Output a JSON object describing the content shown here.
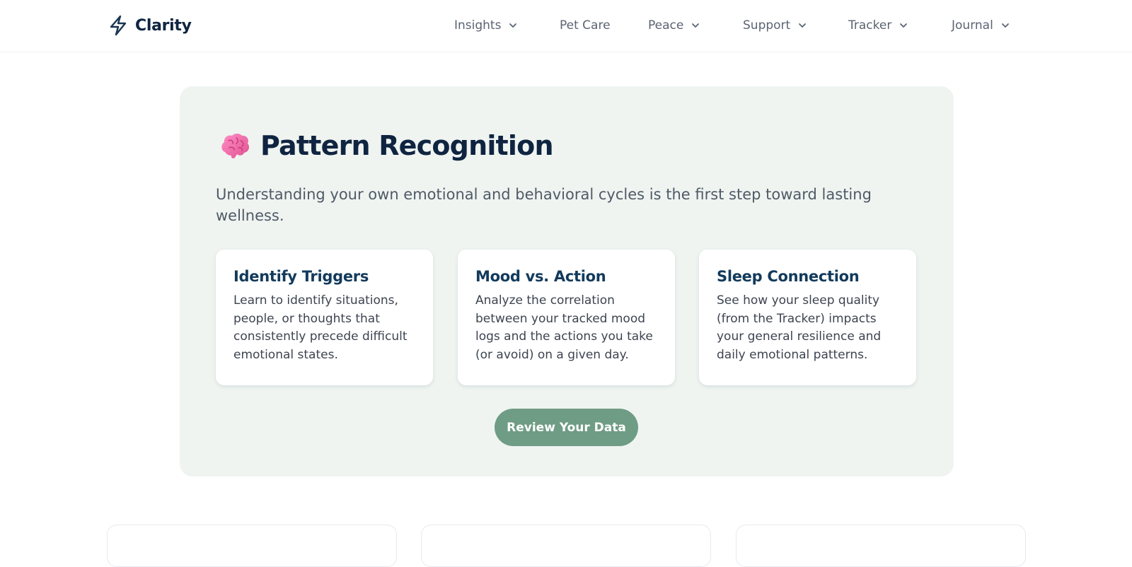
{
  "brand": {
    "name": "Clarity",
    "icon": "lightning-icon"
  },
  "nav": [
    {
      "label": "Insights",
      "dropdown": true
    },
    {
      "label": "Pet Care",
      "dropdown": false
    },
    {
      "label": "Peace",
      "dropdown": true
    },
    {
      "label": "Support",
      "dropdown": true
    },
    {
      "label": "Tracker",
      "dropdown": true
    },
    {
      "label": "Journal",
      "dropdown": true
    }
  ],
  "section": {
    "icon": "brain-icon",
    "title": "Pattern Recognition",
    "subtitle": "Understanding your own emotional and behavioral cycles is the first step toward lasting wellness.",
    "cards": [
      {
        "title": "Identify Triggers",
        "body": "Learn to identify situations, people, or thoughts that consistently precede difficult emotional states."
      },
      {
        "title": "Mood vs. Action",
        "body": "Analyze the correlation between your tracked mood logs and the actions you take (or avoid) on a given day."
      },
      {
        "title": "Sleep Connection",
        "body": "See how your sleep quality (from the Tracker) impacts your general resilience and daily emotional patterns."
      }
    ],
    "cta_label": "Review Your Data"
  },
  "colors": {
    "navy": "#0f2440",
    "panel_bg": "#eff4f1",
    "accent_green": "#6f9c84",
    "card_title": "#123a5c"
  }
}
